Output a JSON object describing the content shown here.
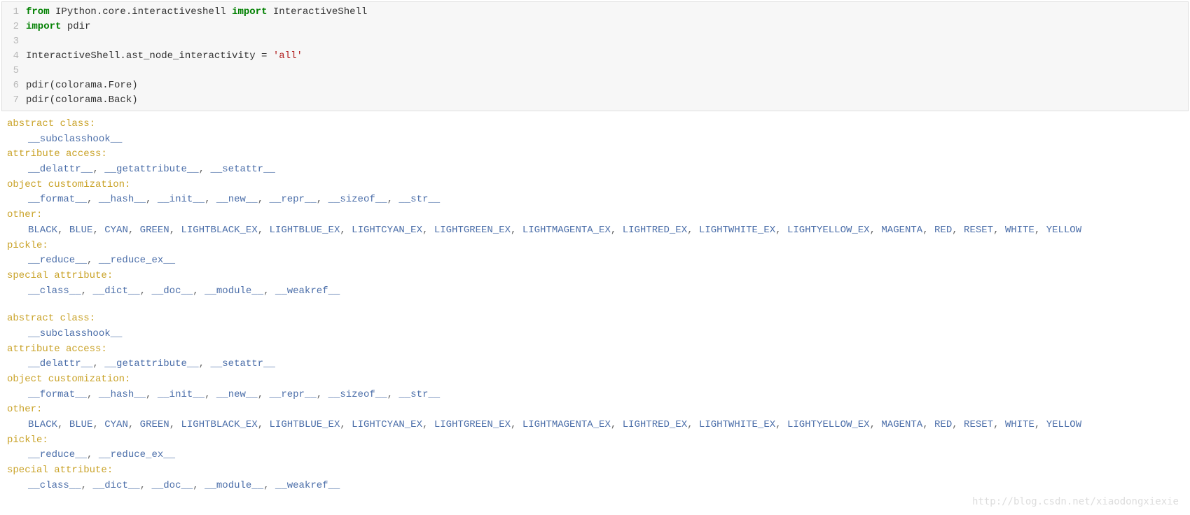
{
  "code": {
    "lines": [
      {
        "n": "1",
        "tokens": [
          {
            "t": "from",
            "c": "kw"
          },
          {
            "t": " IPython.core.interactiveshell ",
            "c": ""
          },
          {
            "t": "import",
            "c": "kw"
          },
          {
            "t": " InteractiveShell",
            "c": ""
          }
        ]
      },
      {
        "n": "2",
        "tokens": [
          {
            "t": "import",
            "c": "kw"
          },
          {
            "t": " pdir",
            "c": ""
          }
        ]
      },
      {
        "n": "3",
        "tokens": []
      },
      {
        "n": "4",
        "tokens": [
          {
            "t": "InteractiveShell.ast_node_interactivity = ",
            "c": ""
          },
          {
            "t": "'all'",
            "c": "str"
          }
        ]
      },
      {
        "n": "5",
        "tokens": []
      },
      {
        "n": "6",
        "tokens": [
          {
            "t": "pdir(colorama.Fore)",
            "c": ""
          }
        ]
      },
      {
        "n": "7",
        "tokens": [
          {
            "t": "pdir(colorama.Back)",
            "c": ""
          }
        ]
      }
    ]
  },
  "outputs": [
    {
      "groups": [
        {
          "category": "abstract class:",
          "items": [
            "__subclasshook__"
          ]
        },
        {
          "category": "attribute access:",
          "items": [
            "__delattr__",
            "__getattribute__",
            "__setattr__"
          ]
        },
        {
          "category": "object customization:",
          "items": [
            "__format__",
            "__hash__",
            "__init__",
            "__new__",
            "__repr__",
            "__sizeof__",
            "__str__"
          ]
        },
        {
          "category": "other:",
          "items": [
            "BLACK",
            "BLUE",
            "CYAN",
            "GREEN",
            "LIGHTBLACK_EX",
            "LIGHTBLUE_EX",
            "LIGHTCYAN_EX",
            "LIGHTGREEN_EX",
            "LIGHTMAGENTA_EX",
            "LIGHTRED_EX",
            "LIGHTWHITE_EX",
            "LIGHTYELLOW_EX",
            "MAGENTA",
            "RED",
            "RESET",
            "WHITE",
            "YELLOW"
          ]
        },
        {
          "category": "pickle:",
          "items": [
            "__reduce__",
            "__reduce_ex__"
          ]
        },
        {
          "category": "special attribute:",
          "items": [
            "__class__",
            "__dict__",
            "__doc__",
            "__module__",
            "__weakref__"
          ]
        }
      ]
    },
    {
      "groups": [
        {
          "category": "abstract class:",
          "items": [
            "__subclasshook__"
          ]
        },
        {
          "category": "attribute access:",
          "items": [
            "__delattr__",
            "__getattribute__",
            "__setattr__"
          ]
        },
        {
          "category": "object customization:",
          "items": [
            "__format__",
            "__hash__",
            "__init__",
            "__new__",
            "__repr__",
            "__sizeof__",
            "__str__"
          ]
        },
        {
          "category": "other:",
          "items": [
            "BLACK",
            "BLUE",
            "CYAN",
            "GREEN",
            "LIGHTBLACK_EX",
            "LIGHTBLUE_EX",
            "LIGHTCYAN_EX",
            "LIGHTGREEN_EX",
            "LIGHTMAGENTA_EX",
            "LIGHTRED_EX",
            "LIGHTWHITE_EX",
            "LIGHTYELLOW_EX",
            "MAGENTA",
            "RED",
            "RESET",
            "WHITE",
            "YELLOW"
          ]
        },
        {
          "category": "pickle:",
          "items": [
            "__reduce__",
            "__reduce_ex__"
          ]
        },
        {
          "category": "special attribute:",
          "items": [
            "__class__",
            "__dict__",
            "__doc__",
            "__module__",
            "__weakref__"
          ]
        }
      ]
    }
  ],
  "watermark": "http://blog.csdn.net/xiaodongxiexie"
}
